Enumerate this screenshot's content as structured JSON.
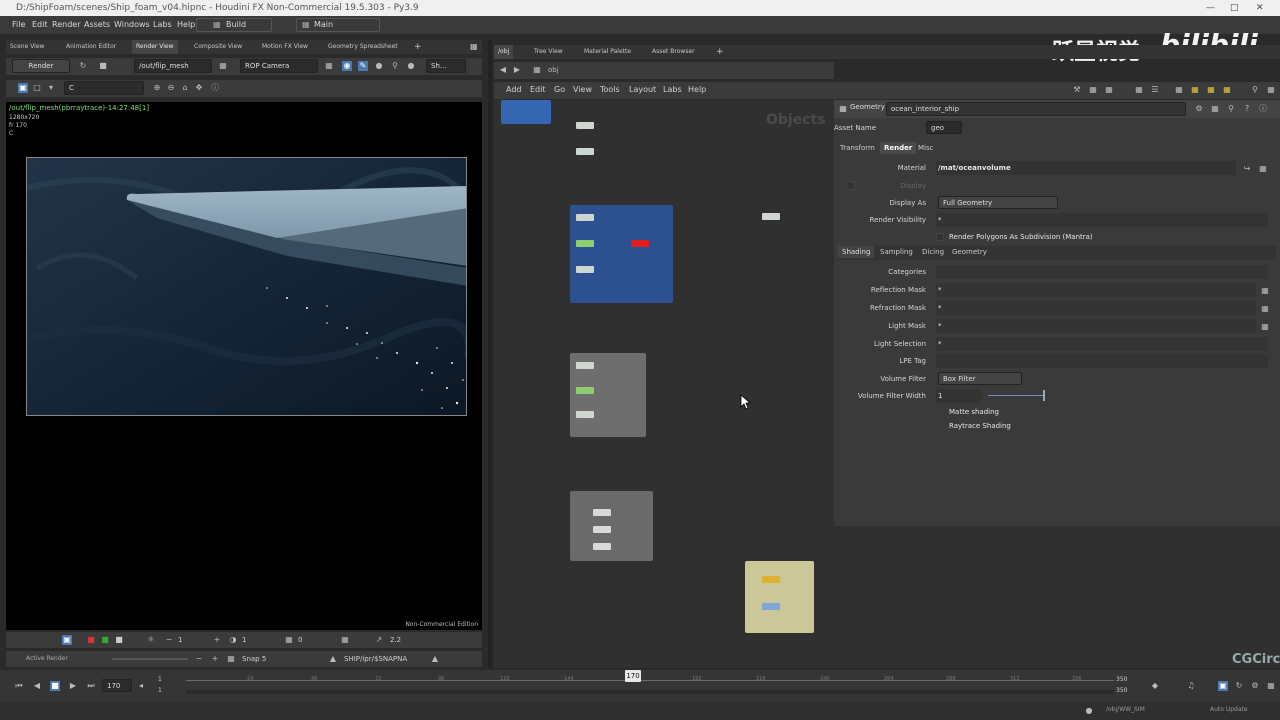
{
  "window_title": "D:/ShipFoam/scenes/Ship_foam_v04.hipnc - Houdini FX Non-Commercial 19.5.303 - Py3.9",
  "watermark": {
    "brand_cn": "跃星视觉",
    "bilibili": "bilibili",
    "cgcircle": "CGCirc"
  },
  "menu": {
    "file": "File",
    "edit": "Edit",
    "render": "Render",
    "assets": "Assets",
    "windows": "Windows",
    "labs": "Labs",
    "help": "Help",
    "build": "Build",
    "main": "Main"
  },
  "left_tabs": [
    "Scene View",
    "Animation Editor",
    "Render View",
    "Composite View",
    "Motion FX View",
    "Geometry Spreadsheet"
  ],
  "render_toolbar": {
    "render_button": "Render",
    "rop_path": "/out/flip_mesh",
    "camera": "ROP Camera",
    "shading": "Sh..."
  },
  "render_toolbar2": {
    "channel": "C"
  },
  "render_info": {
    "line1": "/out/flip_mesh(pbrraytrace)-14:27:48[1]",
    "line2": "1280x720",
    "line3": "fr 170",
    "line4": "C"
  },
  "non_commercial": "Non-Commercial Edition",
  "viewport_bottom": {
    "v1": "1",
    "v2": "1",
    "v3": "0",
    "v4": "2.2"
  },
  "status_row": {
    "active_render": "Active Render",
    "snap": "Snap 5",
    "path": "SHIP/ipr/$SNAPNA"
  },
  "right_tabs": [
    "/obj",
    "Tree View",
    "Material Palette",
    "Asset Browser"
  ],
  "net_path": "obj",
  "net_menu": [
    "Add",
    "Edit",
    "Go",
    "View",
    "Tools",
    "Layout",
    "Labs",
    "Help"
  ],
  "net_watermark": "Objects",
  "params": {
    "type_label": "Geometry",
    "node_name": "ocean_interior_ship",
    "asset_name_label": "Asset Name",
    "asset_name_value": "geo",
    "tabs": [
      "Transform",
      "Render",
      "Misc"
    ],
    "active_tab": "Render",
    "material_label": "Material",
    "material_value": "/mat/oceanvolume",
    "display_label": "Display",
    "display_as_label": "Display As",
    "display_as_value": "Full Geometry",
    "render_visibility_label": "Render Visibility",
    "render_visibility_value": "*",
    "subdiv_label": "Render Polygons As Subdivision (Mantra)",
    "subtabs": [
      "Shading",
      "Sampling",
      "Dicing",
      "Geometry"
    ],
    "categories_label": "Categories",
    "reflection_mask_label": "Reflection Mask",
    "reflection_mask_value": "*",
    "refraction_mask_label": "Refraction Mask",
    "refraction_mask_value": "*",
    "light_mask_label": "Light Mask",
    "light_mask_value": "*",
    "light_selection_label": "Light Selection",
    "light_selection_value": "*",
    "lpe_tag_label": "LPE Tag",
    "volume_filter_label": "Volume Filter",
    "volume_filter_value": "Box Filter",
    "volume_filter_width_label": "Volume Filter Width",
    "volume_filter_width_value": "1",
    "matte_shading_label": "Matte shading",
    "raytrace_shading_label": "Raytrace Shading"
  },
  "timeline": {
    "current_frame": "170",
    "frame_field": "170",
    "start_top": "1",
    "start_bottom": "1",
    "end_top": "350",
    "end_bottom": "350",
    "ticks": [
      "24",
      "48",
      "72",
      "96",
      "120",
      "144",
      "170",
      "192",
      "216",
      "240",
      "264",
      "288",
      "312",
      "336"
    ]
  },
  "status_bar": {
    "path": "/obj/WW_SIM",
    "auto_update": "Auto Update"
  }
}
